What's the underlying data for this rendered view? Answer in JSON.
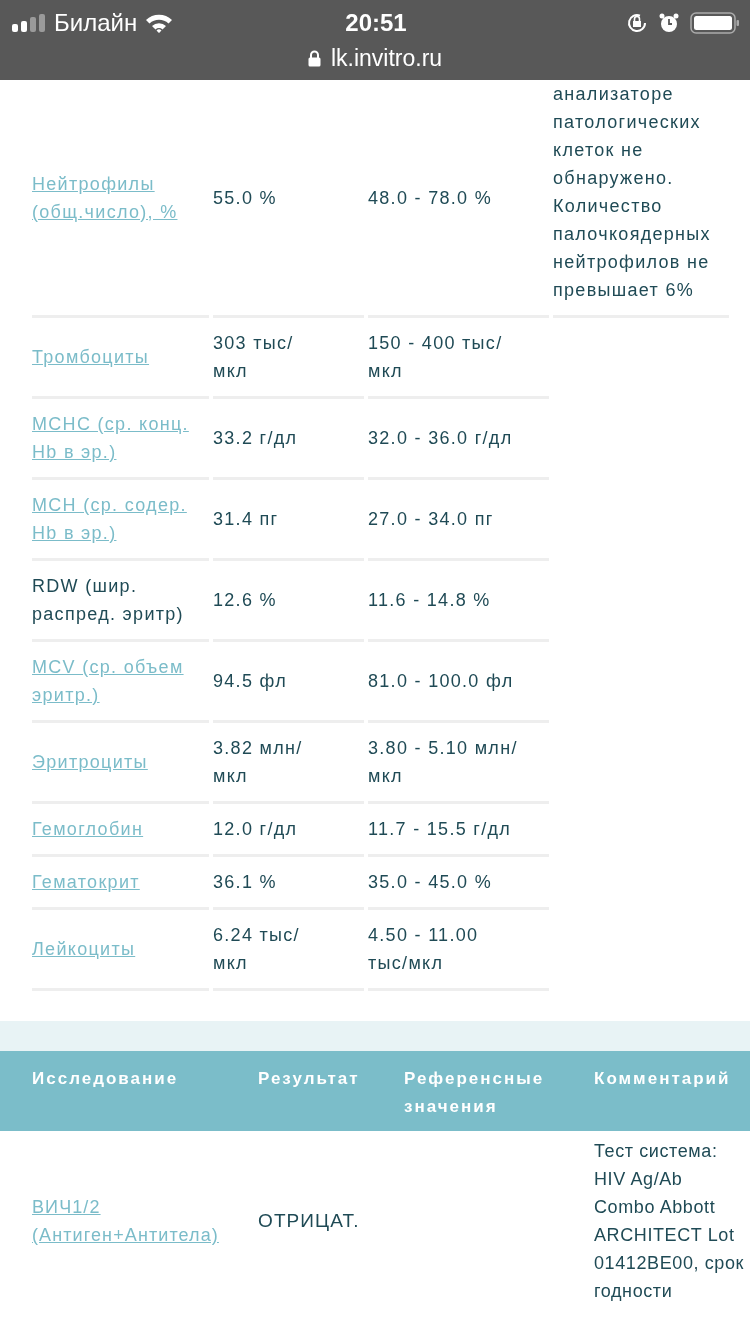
{
  "status_bar": {
    "carrier": "Билайн",
    "time": "20:51",
    "url": "lk.invitro.ru"
  },
  "results": [
    {
      "name": "Нейтрофилы (общ.число), %",
      "linked": true,
      "result": "55.0 %",
      "reference": "48.0 - 78.0 %",
      "comment": "анализаторе патологических клеток не обнаружено. Количество палочкоядерных нейтрофилов не превышает 6%"
    },
    {
      "name": "Тромбоциты",
      "linked": true,
      "result": "303 тыс/ мкл",
      "reference": "150 - 400 тыс/ мкл"
    },
    {
      "name": "MCHC (ср. конц. Hb в эр.)",
      "linked": true,
      "result": "33.2 г/дл",
      "reference": "32.0 - 36.0 г/дл"
    },
    {
      "name": "MCH (ср. содер. Hb в эр.)",
      "linked": true,
      "result": "31.4 пг",
      "reference": "27.0 - 34.0 пг"
    },
    {
      "name": "RDW (шир. распред. эритр)",
      "linked": false,
      "result": "12.6 %",
      "reference": "11.6 - 14.8 %"
    },
    {
      "name": "MCV (ср. объем эритр.)",
      "linked": true,
      "result": "94.5 фл",
      "reference": "81.0 - 100.0 фл"
    },
    {
      "name": "Эритроциты",
      "linked": true,
      "result": "3.82 млн/ мкл",
      "reference": "3.80 - 5.10 млн/мкл"
    },
    {
      "name": "Гемоглобин",
      "linked": true,
      "result": "12.0 г/дл",
      "reference": "11.7 - 15.5 г/дл"
    },
    {
      "name": "Гематокрит",
      "linked": true,
      "result": "36.1 %",
      "reference": "35.0 - 45.0 %"
    },
    {
      "name": "Лейкоциты",
      "linked": true,
      "result": "6.24 тыс/ мкл",
      "reference": "4.50 - 11.00 тыс/мкл"
    }
  ],
  "table2": {
    "columns": [
      "Исследование",
      "Результат",
      "Референсные значения",
      "Комментарий"
    ],
    "rows": [
      {
        "name": "ВИЧ1/2 (Антиген+Антитела)",
        "linked": true,
        "result": "ОТРИЦАТ.",
        "comment": "Тест система: HIV Ag/Ab Combo Abbott ARCHITECT Lot 01412BE00, срок годности"
      }
    ]
  }
}
